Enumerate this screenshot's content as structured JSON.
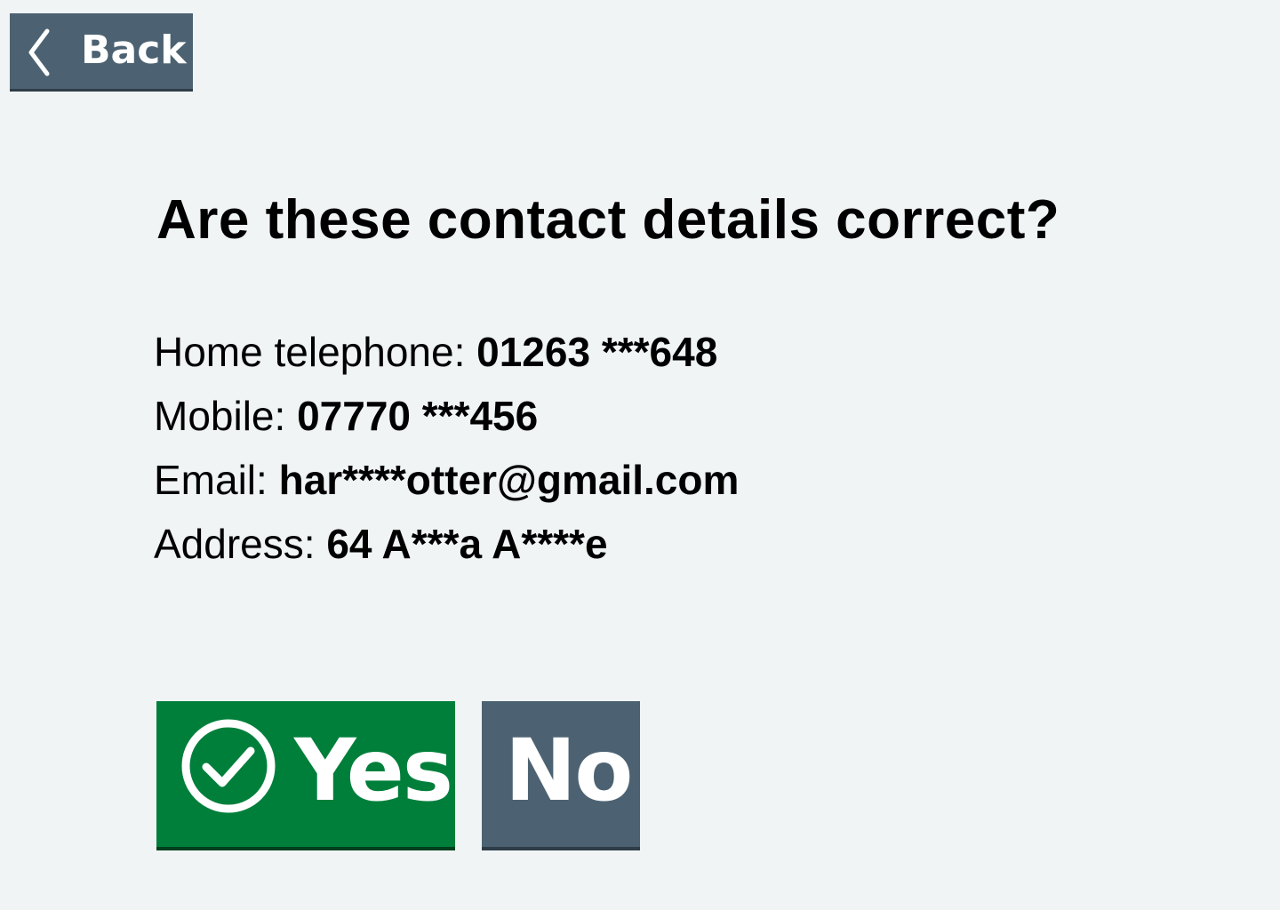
{
  "back_button": {
    "label": "Back",
    "icon": "chevron-left-icon"
  },
  "title": "Are these contact details correct?",
  "details": [
    {
      "label": "Home telephone:",
      "value": "01263 ***648"
    },
    {
      "label": "Mobile:",
      "value": "07770 ***456"
    },
    {
      "label": "Email:",
      "value": "har****otter@gmail.com"
    },
    {
      "label": "Address:",
      "value": "64 A***a A****e"
    }
  ],
  "yes_button": {
    "label": "Yes",
    "icon": "check-circle-icon",
    "color": "#007f3b"
  },
  "no_button": {
    "label": "No",
    "color": "#4c6272"
  },
  "colors": {
    "background": "#f0f4f5",
    "secondary_button": "#4c6272",
    "confirm_button": "#007f3b",
    "text": "#000000"
  }
}
